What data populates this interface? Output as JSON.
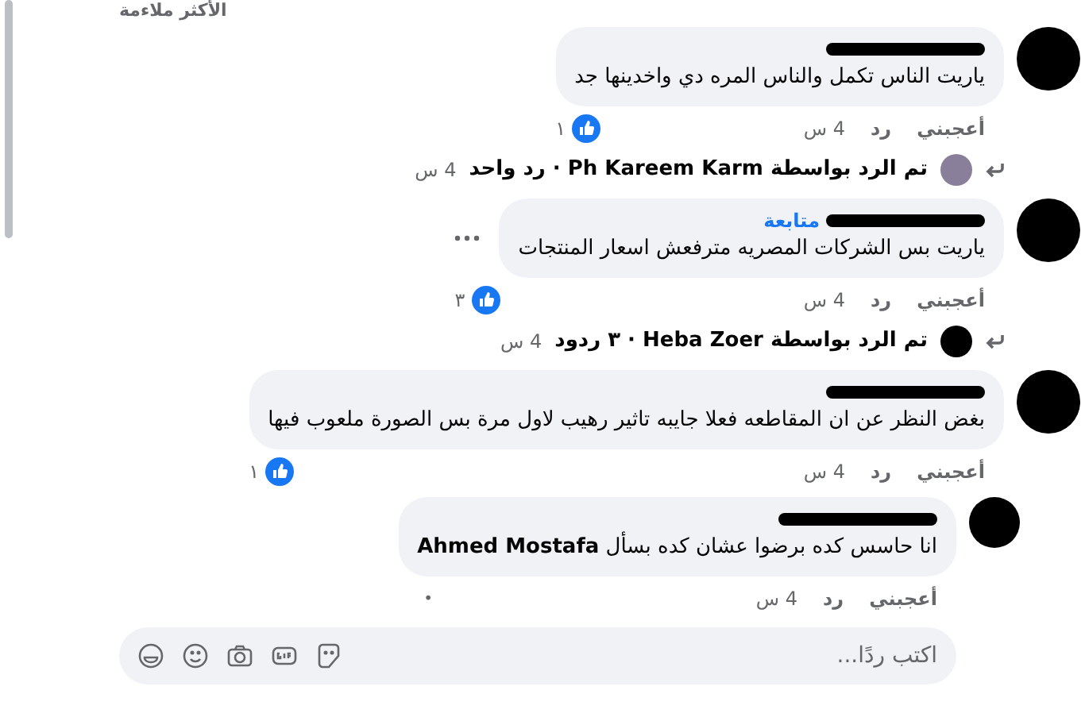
{
  "sort_label": "الأكثر ملاءمة",
  "comments": [
    {
      "avatar": {
        "kind": "redacted"
      },
      "text": "ياريت الناس تكمل والناس المره دي واخدينها جد",
      "like_count": "١",
      "actions": [
        "أعجبني",
        "رد",
        "4 س"
      ],
      "replies_summary": {
        "avatar": {
          "kind": "photo"
        },
        "text": "تم الرد بواسطة Ph Kareem Karm · رد واحد",
        "time": "4 س"
      }
    },
    {
      "avatar": {
        "kind": "redacted"
      },
      "follow_label": "متابعة",
      "text": "ياريت بس الشركات المصريه مترفعش اسعار المنتجات",
      "like_count": "٣",
      "actions": [
        "أعجبني",
        "رد",
        "4 س"
      ],
      "menu_visible": true,
      "replies_summary": {
        "avatar": {
          "kind": "redacted"
        },
        "text": "تم الرد بواسطة Heba Zoer · ٣ ردود",
        "time": "4 س"
      }
    },
    {
      "avatar": {
        "kind": "redacted"
      },
      "text": "بغض النظر عن ان المقاطعه فعلا جايبه تاثير رهيب لاول مرة بس الصورة ملعوب فيها",
      "like_count": "١",
      "actions": [
        "أعجبني",
        "رد",
        "4 س"
      ],
      "children": [
        {
          "avatar": {
            "kind": "redacted"
          },
          "text": "انا حاسس كده برضوا عشان كده بسأل **Ahmed Mostafa**",
          "actions": [
            "أعجبني",
            "رد",
            "4 س"
          ],
          "trailing_mark": "•"
        }
      ]
    }
  ],
  "composer": {
    "placeholder": "اكتب ردًا..."
  }
}
